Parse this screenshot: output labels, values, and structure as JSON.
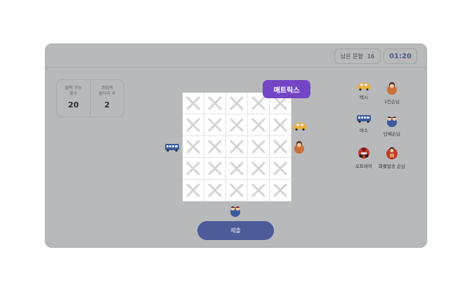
{
  "header": {
    "remaining_label": "남은 문항",
    "remaining_count": "16",
    "timer": "01:20"
  },
  "stats": {
    "clicks_label": "클릭 가능\n횟수",
    "clicks_value": "20",
    "answers_label": "정답의\n물타리 수",
    "answers_value": "2"
  },
  "matrix": {
    "badge": "매트릭스",
    "rows": 5,
    "cols": 5,
    "cell_state": "blocked"
  },
  "legend": {
    "items": [
      {
        "label": "택시",
        "icon": "taxi-icon"
      },
      {
        "label": "1인손님",
        "icon": "single-passenger-icon"
      },
      {
        "label": "버스",
        "icon": "bus-icon"
      },
      {
        "label": "단체손님",
        "icon": "group-passengers-icon"
      },
      {
        "label": "오토바이",
        "icon": "motorcycle-icon"
      },
      {
        "label": "화물발송 손님",
        "icon": "cargo-customer-icon"
      }
    ]
  },
  "submit_label": "제출",
  "colors": {
    "accent": "#7446c5",
    "submit": "#4d5c99",
    "timer_text": "#4d5c86",
    "taxi": "#e8b23a",
    "bus": "#3a5a9c",
    "passenger": "#c9703a",
    "moto": "#c0392b"
  }
}
